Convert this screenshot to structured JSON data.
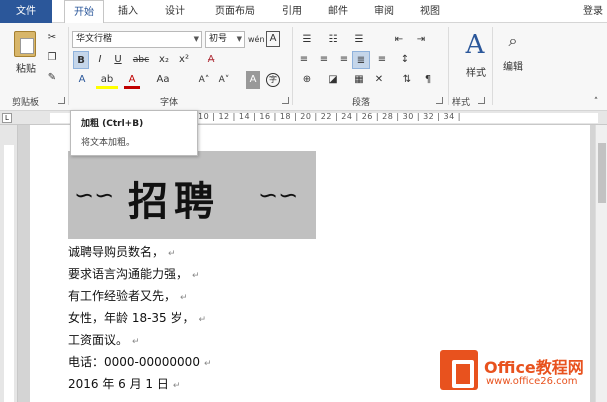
{
  "menubar": {
    "tabs": [
      "文件",
      "开始",
      "插入",
      "设计",
      "页面布局",
      "引用",
      "邮件",
      "审阅",
      "视图"
    ],
    "login": "登录"
  },
  "ribbon": {
    "clipboard": {
      "paste": "粘贴",
      "label": "剪贴板"
    },
    "font": {
      "name": "华文行楷",
      "size": "初号",
      "bold": "B",
      "italic": "I",
      "underline": "U",
      "strike": "abc",
      "sub": "x₂",
      "sup": "x²",
      "aa": "Aa",
      "grow": "A˄",
      "shrink": "A˅",
      "label": "字体"
    },
    "paragraph": {
      "label": "段落"
    },
    "styles": {
      "button": "样式",
      "label": "样式"
    },
    "editing": {
      "button": "编辑"
    }
  },
  "tooltip": {
    "title": "加粗 (Ctrl+B)",
    "desc": "将文本加粗。"
  },
  "ruler": {
    "numbers": "10 | 12 | 14 | 16 | 18 | 20 | 22 | 24 | 26 | 28 | 30 | 32 | 34 |"
  },
  "document": {
    "title": "招聘",
    "ornament_left": "∽∽",
    "ornament_right": "∽∽",
    "lines": [
      "诚聘导购员数名，",
      "要求语言沟通能力强，",
      "有工作经验者又先，",
      "女性，年龄 18-35 岁，",
      "工资面议。",
      "电话：0000-00000000",
      "2016 年 6 月 1 日"
    ],
    "para_mark": "↵"
  },
  "watermark": {
    "line1": "Office教程网",
    "line2": "www.office26.com"
  },
  "colors": {
    "brand": "#2b579a",
    "logo": "#e8521e"
  }
}
